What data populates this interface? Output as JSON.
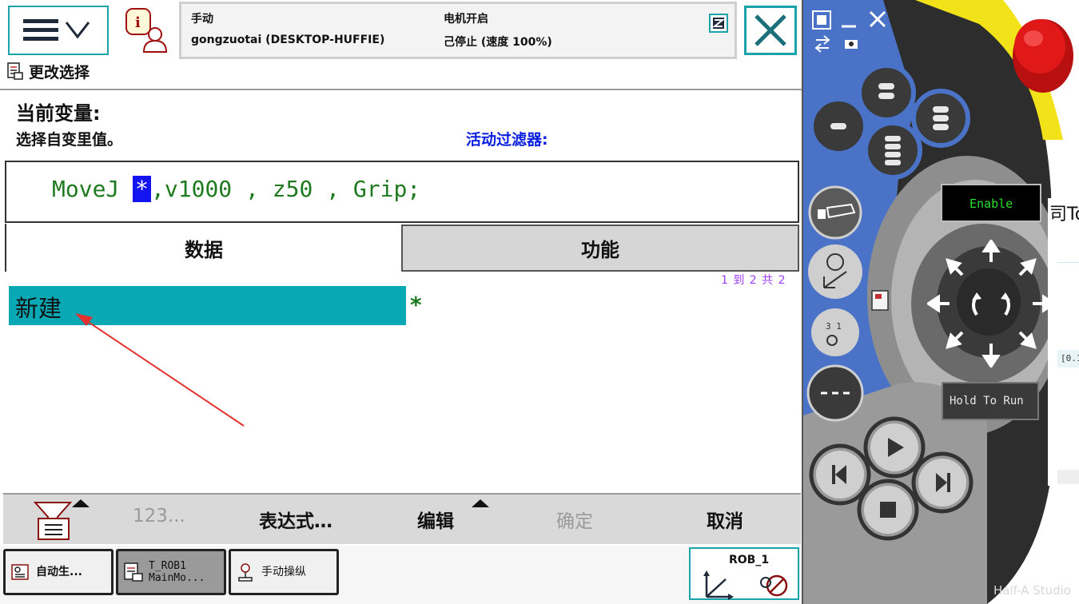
{
  "status": {
    "mode": "手动",
    "system": "gongzuotai (DESKTOP-HUFFIE)",
    "motor": "电机开启",
    "state": "己停止 (速度 100%)"
  },
  "view_title": "更改选择",
  "current_variable_label": "当前变量:",
  "instruction": "选择自变里值。",
  "active_filter_label": "活动过滤器:",
  "code": {
    "before": "MoveJ ",
    "selected": "*",
    "after": ",v1000 , z50 , Grip;"
  },
  "tabs": [
    "数据",
    "功能"
  ],
  "list": {
    "count": "1 到 2 共 2",
    "items": [
      "新建"
    ],
    "values": [
      "*"
    ]
  },
  "commands": {
    "numeric": "123...",
    "expression": "表达式…",
    "edit": "编辑",
    "ok": "确定",
    "cancel": "取消"
  },
  "taskbar": {
    "auto": "自动生...",
    "task_line1": "T_ROB1",
    "task_line2": "MainMo...",
    "jog": "手动操纵",
    "robot": "ROB_1"
  },
  "pendant": {
    "enable": "Enable",
    "hold_to_run": "Hold To Run",
    "side_text": "司To",
    "side_value": "[0.1"
  },
  "watermark": "Half-A Studio",
  "colors": {
    "accent": "#1aa3a8",
    "selection": "#08a8b4",
    "code_green": "#1f7a1f",
    "highlight_blue": "#1414f0",
    "filter_blue": "#0a1fe0",
    "pendant_blue": "#4a73c8",
    "emergency_red": "#e01818",
    "pendant_yellow": "#f2e21a"
  }
}
